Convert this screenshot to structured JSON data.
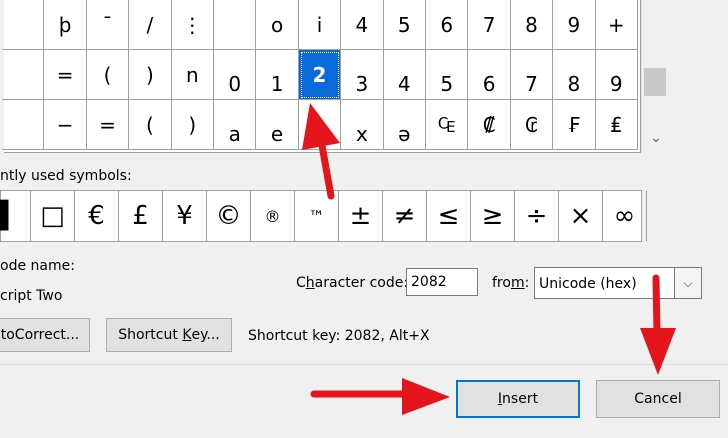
{
  "grid": {
    "rows": [
      [
        "",
        "þ",
        "¯",
        "/",
        "⋮",
        "",
        "o",
        "i",
        "4",
        "5",
        "6",
        "7",
        "8",
        "9",
        "+"
      ],
      [
        "",
        "=",
        "(",
        ")",
        "n",
        "0",
        "1",
        "2",
        "3",
        "4",
        "5",
        "6",
        "7",
        "8",
        "9"
      ],
      [
        "",
        "−",
        "=",
        "(",
        ")",
        "a",
        "e",
        "o",
        "x",
        "ə",
        "₠",
        "₡",
        "₢",
        "₣",
        "₤"
      ]
    ],
    "selected": "2"
  },
  "recent": {
    "label": "ntly used symbols:",
    "items": [
      "▌",
      "□",
      "€",
      "£",
      "¥",
      "©",
      "®",
      "™",
      "±",
      "≠",
      "≤",
      "≥",
      "÷",
      "×",
      "∞"
    ]
  },
  "unicode_name": {
    "label": "ode name:",
    "value": "cript Two"
  },
  "character_code": {
    "label_prefix": "C",
    "label_underlined": "h",
    "label_suffix": "aracter code:",
    "value": "2082"
  },
  "from": {
    "label_prefix": "fro",
    "label_underlined": "m",
    "label_suffix": ":",
    "value": "Unicode (hex)"
  },
  "buttons": {
    "autocorrect": "toCorrect...",
    "shortcut_prefix": "Shortcut ",
    "shortcut_underlined": "K",
    "shortcut_suffix": "ey...",
    "insert_underlined": "I",
    "insert_suffix": "nsert",
    "cancel": "Cancel"
  },
  "shortcut_key_text": "Shortcut key: 2082, Alt+X",
  "colors": {
    "selection": "#0a6ad8",
    "arrow": "#e3141b",
    "default_button_border": "#0078d7"
  }
}
